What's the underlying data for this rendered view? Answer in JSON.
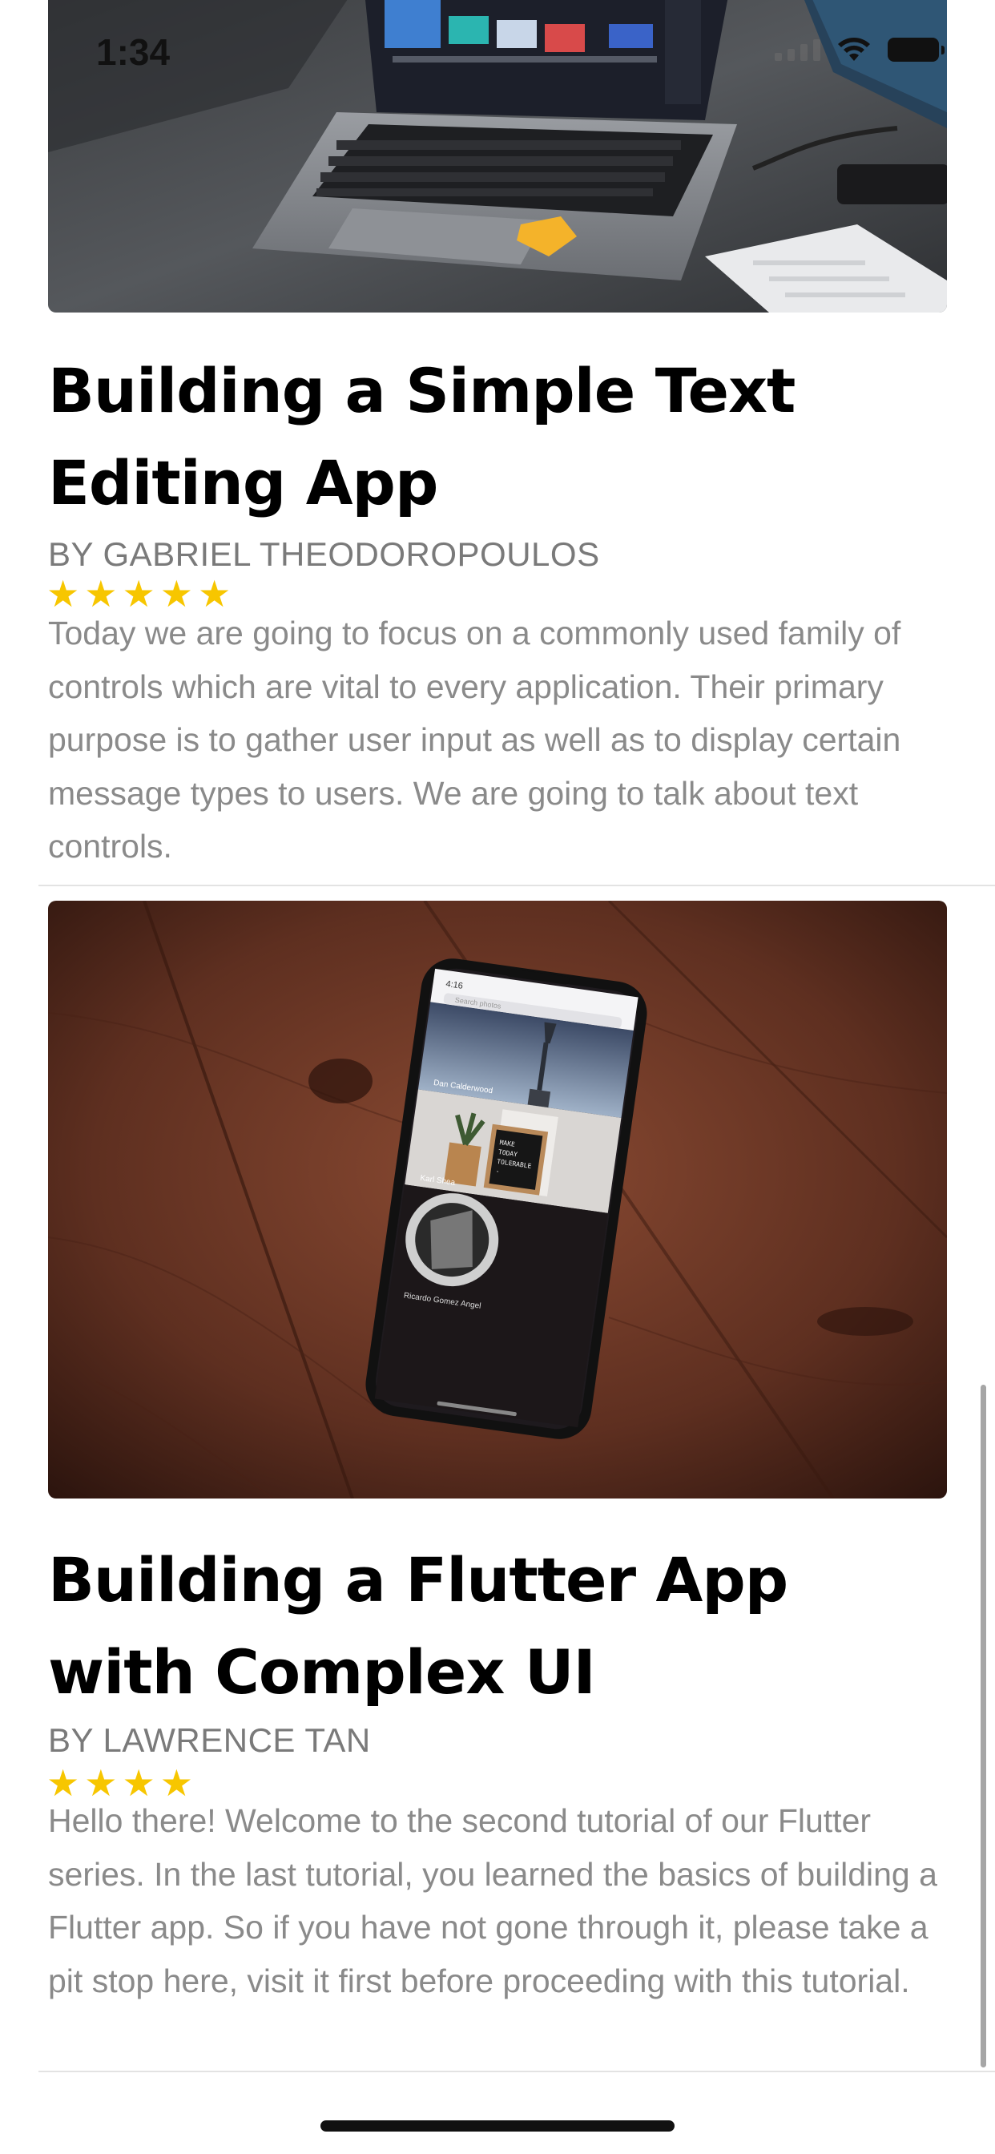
{
  "status_bar": {
    "time": "1:34",
    "icons": [
      "cellular-signal-icon",
      "wifi-icon",
      "battery-icon"
    ]
  },
  "feed": {
    "articles": [
      {
        "image": "laptop-on-desk-photo",
        "title": "Building a Simple Text Editing App",
        "author": "BY GABRIEL THEODOROPOULOS",
        "rating": 5,
        "excerpt": "Today we are going to focus on a commonly used family of controls which are vital to every application. Their primary purpose is to gather user input as well as to display certain message types to users. We are going to talk about text controls."
      },
      {
        "image": "phone-on-wooden-table-photo",
        "title": "Building a Flutter App with Complex UI",
        "author": "BY LAWRENCE TAN",
        "rating": 4,
        "excerpt": "Hello there! Welcome to the second tutorial of our Flutter series. In the last tutorial, you learned the basics of building a Flutter app. So if you have not gone through it, please take a pit stop here, visit it first before proceeding with this tutorial.",
        "phone_screen": {
          "time": "4:16",
          "search_placeholder": "Search photos",
          "photo_captions": [
            "Dan Calderwood",
            "Karl Shea",
            "Ricardo Gomez Angel"
          ],
          "letter_board": [
            "MAKE",
            "TODAY",
            "TOLERABLE",
            "-"
          ]
        }
      }
    ]
  },
  "colors": {
    "star": "#f7c600",
    "author_text": "#7a7a7a",
    "excerpt_text": "#8a8a8a",
    "divider": "#e3e3e3"
  }
}
